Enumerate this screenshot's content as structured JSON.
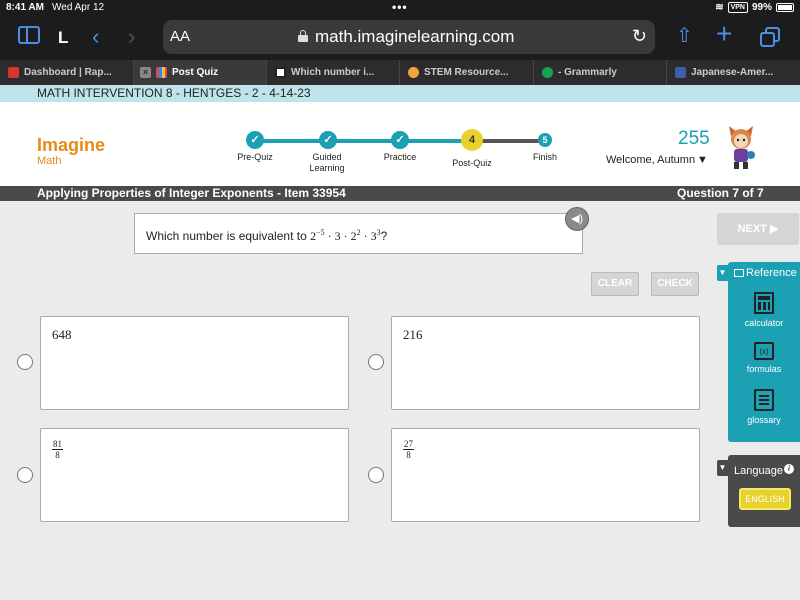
{
  "status": {
    "time": "8:41 AM",
    "date": "Wed Apr 12",
    "vpn": "VPN",
    "battery": "99%"
  },
  "browser": {
    "text_size_button": "AA",
    "url": "math.imaginelearning.com",
    "l_label": "L",
    "tabs": [
      {
        "label": "Dashboard | Rap...",
        "fav_color": "#d9362a"
      },
      {
        "label": "Post Quiz",
        "fav_color": "#e04e3a"
      },
      {
        "label": "Which number i...",
        "fav_color": "#ffffff"
      },
      {
        "label": "STEM Resource...",
        "fav_color": "#f2a33b"
      },
      {
        "label": "- Grammarly",
        "fav_color": "#16a34a"
      },
      {
        "label": "Japanese-Amer...",
        "fav_color": "#3b5fa8"
      }
    ]
  },
  "course": {
    "title": "MATH INTERVENTION 8 - HENTGES - 2 - 4-14-23"
  },
  "header": {
    "logo_top": "Imagine",
    "logo_bottom": "Math",
    "steps": [
      {
        "num": "✓",
        "label": "Pre-Quiz"
      },
      {
        "num": "✓",
        "label": "Guided Learning"
      },
      {
        "num": "✓",
        "label": "Practice"
      },
      {
        "num": "4",
        "label": "Post-Quiz"
      },
      {
        "num": "5",
        "label": "Finish"
      }
    ],
    "score": "255",
    "welcome": "Welcome, Autumn"
  },
  "item": {
    "title": "Applying Properties of Integer Exponents - Item 33954",
    "count": "Question 7 of 7"
  },
  "question": {
    "prefix": "Which number is equivalent to ",
    "b1": "2",
    "e1": "−5",
    "b2": "3",
    "b3": "2",
    "e3": "2",
    "b4": "3",
    "e4": "3",
    "suffix": "?"
  },
  "buttons": {
    "next": "NEXT ▶",
    "clear": "CLEAR",
    "check": "CHECK"
  },
  "choices": {
    "a": "648",
    "b": "216",
    "c": {
      "num": "81",
      "den": "8"
    },
    "d": {
      "num": "27",
      "den": "8"
    }
  },
  "reference": {
    "title": "Reference",
    "calculator": "calculator",
    "formulas": "formulas",
    "formula_icon": "(x)",
    "glossary": "glossary"
  },
  "language": {
    "title": "Language",
    "english": "ENGLISH"
  },
  "colors": {
    "teal": "#1ba0b4",
    "orange": "#e78b1b",
    "yellow": "#e7d22c",
    "dark": "#4a4a4a"
  }
}
